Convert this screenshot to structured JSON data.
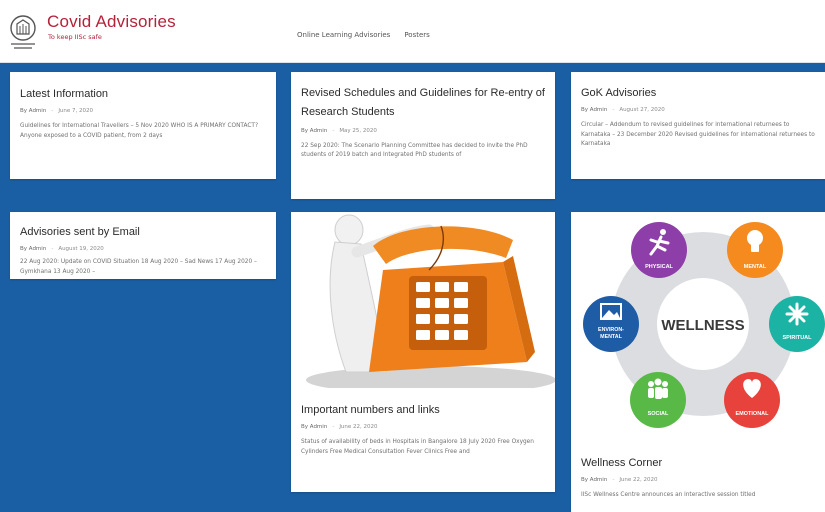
{
  "site": {
    "title": "Covid Advisories",
    "tagline": "To keep IISc safe"
  },
  "nav": [
    {
      "label": "Online Learning Advisories"
    },
    {
      "label": "Posters"
    }
  ],
  "cards": {
    "latest": {
      "title": "Latest Information",
      "author": "By Admin",
      "date": "June 7, 2020",
      "excerpt": "Guidelines for International Travellers – 5 Nov 2020 WHO IS A PRIMARY CONTACT? Anyone exposed to a COVID patient, from 2 days"
    },
    "revised": {
      "title": "Revised Schedules and Guidelines for Re-entry of Research Students",
      "author": "By Admin",
      "date": "May 25, 2020",
      "excerpt": "22 Sep 2020: The Scenario Planning Committee has decided to invite the PhD students of 2019 batch and Integrated PhD students of"
    },
    "gok": {
      "title": "GoK Advisories",
      "author": "By Admin",
      "date": "August 27, 2020",
      "excerpt": "Circular – Addendum to revised guidelines for international returnees to Karnataka – 23 December 2020 Revised guidelines for international returnees to Karnataka"
    },
    "email": {
      "title": "Advisories sent by Email",
      "author": "By Admin",
      "date": "August 19, 2020",
      "excerpt": "22 Aug 2020: Update on COVID Situation 18 Aug 2020 – Sad News 17 Aug 2020 – Gymkhana 13 Aug 2020 –"
    },
    "numbers": {
      "title": "Important numbers and links",
      "author": "By Admin",
      "date": "June 22, 2020",
      "excerpt": "Status of availability of beds in Hospitals in Bangalore 18 July 2020 Free Oxygen Cylinders Free Medical Consultation Fever Clinics Free and"
    },
    "wellness": {
      "title": "Wellness Corner",
      "author": "By Admin",
      "date": "June 22, 2020",
      "excerpt": "IISc Wellness Centre announces an interactive session titled"
    }
  },
  "wellness_graphic": {
    "center_label": "WELLNESS",
    "nodes": [
      {
        "label": "PHYSICAL",
        "color": "#8e3ea8",
        "icon": "running-person-icon"
      },
      {
        "label": "MENTAL",
        "color": "#f58a1f",
        "icon": "lightbulb-icon"
      },
      {
        "label": "SPIRITUAL",
        "color": "#1bb3a3",
        "icon": "lotus-icon"
      },
      {
        "label": "EMOTIONAL",
        "color": "#e8423c",
        "icon": "heart-icon"
      },
      {
        "label": "SOCIAL",
        "color": "#58b947",
        "icon": "people-icon"
      },
      {
        "label": "ENVIRON-",
        "label2": "MENTAL",
        "color": "#1f5ca6",
        "icon": "landscape-icon"
      }
    ]
  },
  "colors": {
    "background": "#1a5fa4",
    "brand": "#b4223a",
    "phone": "#ef7f1a"
  }
}
